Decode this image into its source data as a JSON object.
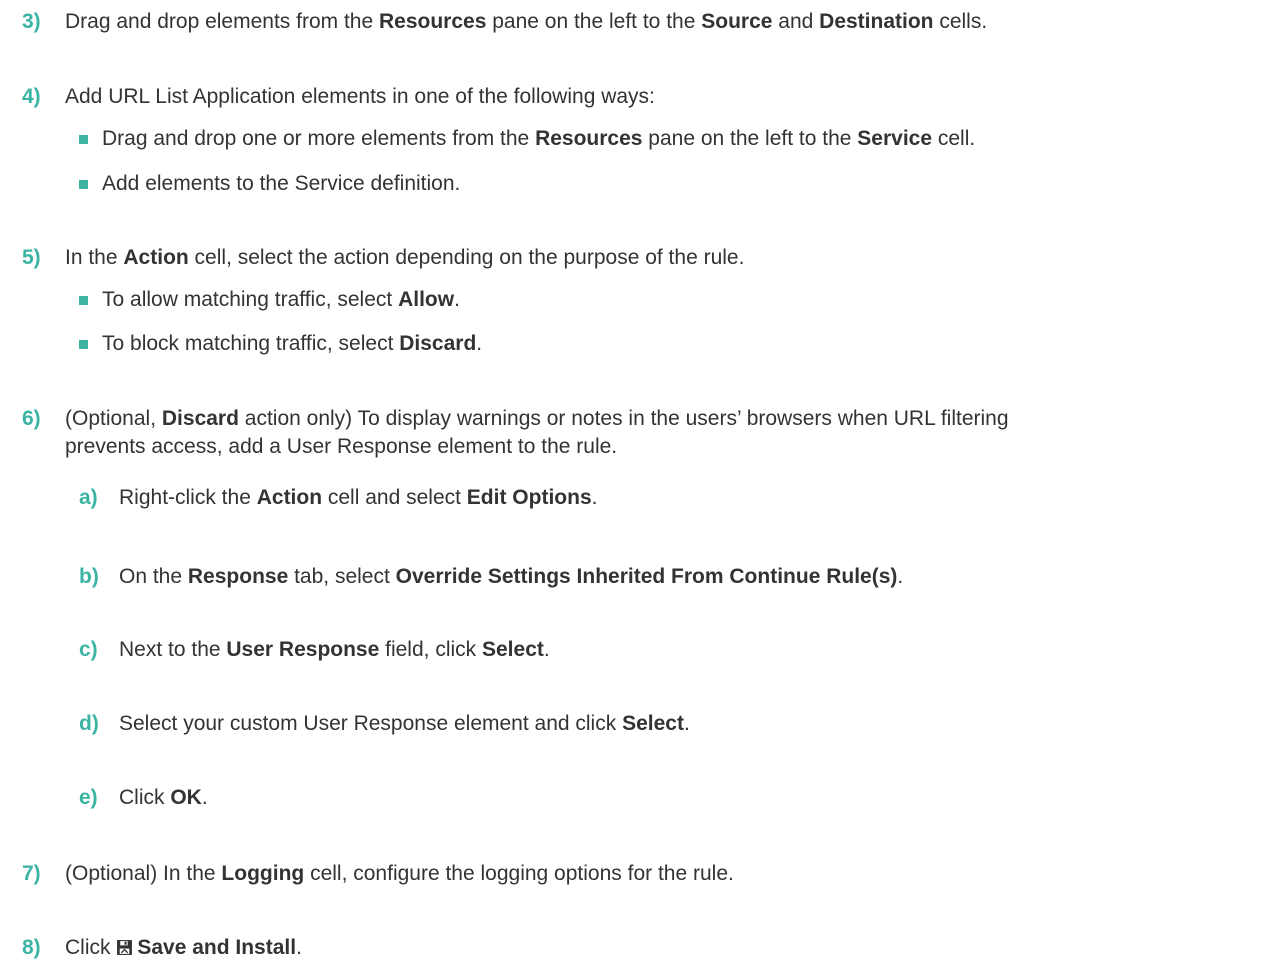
{
  "steps": [
    {
      "num": "3)",
      "parts": [
        "Drag and drop elements from the ",
        "Resources",
        " pane on the left to the ",
        "Source",
        " and ",
        "Destination",
        " cells."
      ]
    },
    {
      "num": "4)",
      "text": "Add URL List Application elements in one of the following ways:",
      "bullets": [
        {
          "parts": [
            "Drag and drop one or more elements from the ",
            "Resources",
            " pane on the left to the ",
            "Service",
            " cell."
          ]
        },
        {
          "text": "Add elements to the Service definition."
        }
      ]
    },
    {
      "num": "5)",
      "parts": [
        "In the ",
        "Action",
        " cell, select the action depending on the purpose of the rule."
      ],
      "bullets": [
        {
          "parts": [
            "To allow matching traffic, select ",
            "Allow",
            "."
          ]
        },
        {
          "parts": [
            "To block matching traffic, select ",
            "Discard",
            "."
          ]
        }
      ]
    },
    {
      "num": "6)",
      "parts": [
        "(Optional, ",
        "Discard",
        " action only) To display warnings or notes in the users’ browsers when URL filtering"
      ],
      "line2": "prevents access, add a User Response element to the rule.",
      "substeps": [
        {
          "letter": "a)",
          "parts": [
            "Right-click the ",
            "Action",
            " cell and select ",
            "Edit Options",
            "."
          ]
        },
        {
          "letter": "b)",
          "parts": [
            "On the ",
            "Response",
            " tab, select ",
            "Override Settings Inherited From Continue Rule(s)",
            "."
          ]
        },
        {
          "letter": "c)",
          "parts": [
            "Next to the ",
            "User Response",
            " field, click ",
            "Select",
            "."
          ]
        },
        {
          "letter": "d)",
          "parts": [
            "Select your custom User Response element and click ",
            "Select",
            "."
          ]
        },
        {
          "letter": "e)",
          "parts": [
            "Click ",
            "OK",
            "."
          ]
        }
      ]
    },
    {
      "num": "7)",
      "parts": [
        "(Optional) In the ",
        "Logging",
        " cell, configure the logging options for the rule."
      ]
    },
    {
      "num": "8)",
      "parts": [
        "Click ",
        "Save and Install",
        "."
      ],
      "icon": "save-icon"
    }
  ]
}
